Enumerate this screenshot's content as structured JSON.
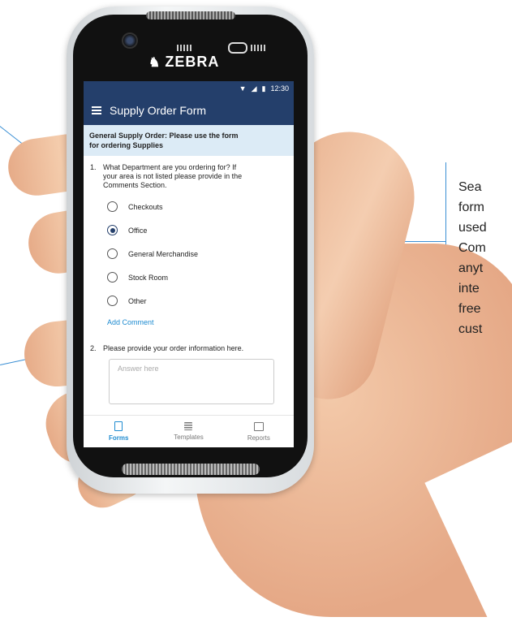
{
  "device": {
    "brand": "ZEBRA"
  },
  "status_bar": {
    "time": "12:30"
  },
  "app_bar": {
    "title": "Supply Order Form"
  },
  "banner": {
    "line1": "General Supply Order: Please use the form",
    "line2": "for ordering Supplies"
  },
  "question1": {
    "number": "1.",
    "lines": [
      "What Department are you ordering for? If",
      "your area is not listed please provide in the",
      "Comments Section."
    ],
    "options": [
      {
        "label": "Checkouts",
        "selected": false
      },
      {
        "label": "Office",
        "selected": true
      },
      {
        "label": "General Merchandise",
        "selected": false
      },
      {
        "label": "Stock Room",
        "selected": false
      },
      {
        "label": "Other",
        "selected": false
      }
    ],
    "add_comment": "Add Comment"
  },
  "question2": {
    "number": "2.",
    "text": "Please provide your order information here.",
    "placeholder": "Answer here"
  },
  "nav": [
    {
      "label": "Forms",
      "icon": "forms-icon",
      "active": true
    },
    {
      "label": "Templates",
      "icon": "templates-icon",
      "active": false
    },
    {
      "label": "Reports",
      "icon": "reports-icon",
      "active": false
    }
  ],
  "side_text": [
    "Sea",
    "form",
    "used",
    "Com",
    "anyt",
    "inte",
    "free",
    "cust"
  ],
  "colors": {
    "app_bar": "#243f6b",
    "accent": "#1e8bd0",
    "banner_bg": "#dcebf6",
    "callout_line": "#3b8fd4"
  }
}
